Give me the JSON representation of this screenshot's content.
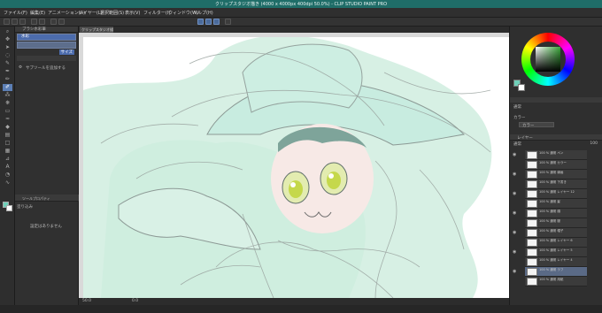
{
  "window": {
    "title": "クリップスタジオ描き (4000 x 4000px 400dpi 50.0%) - CLIP STUDIO PAINT PRO"
  },
  "menu": [
    "ファイル(F)",
    "編集(E)",
    "アニメーション(A)",
    "レイヤー(L)",
    "選択範囲(S)",
    "表示(V)",
    "フィルター(I)",
    "ウィンドウ(W)",
    "ヘルプ(H)"
  ],
  "tool_panel": {
    "header": "ブラシ水彩筆",
    "subtools": [
      "水彩",
      "",
      ""
    ],
    "size_value": "サイズ",
    "add_label": "サブツールを追加する",
    "property_header": "ツールプロパティ",
    "property_sub": "塗り込み",
    "message": "設定はありません"
  },
  "canvas": {
    "tab_label": "クリップスタジオ描き*"
  },
  "color_panel": {
    "main_color": "#6fd0b9"
  },
  "layer_panel": {
    "header": "レイヤー",
    "blend_mode": "通常",
    "opacity": "100",
    "color_label": "カラー",
    "layers": [
      "100 % 通常 ペン",
      "100 % 通常 カラー",
      "100 % 通常 線画",
      "100 % 通常 下書き",
      "100 % 通常 レイヤー 12",
      "100 % 通常 髪",
      "100 % 通常 顔",
      "100 % 通常 服",
      "100 % 通常 帽子",
      "100 % 通常 レイヤー 6",
      "100 % 通常 レイヤー 5",
      "100 % 通常 レイヤー 4",
      "100 % 通常 ラフ",
      "100 % 通常 用紙"
    ]
  },
  "status": {
    "zoom": "50.0",
    "angle": "0.0"
  }
}
